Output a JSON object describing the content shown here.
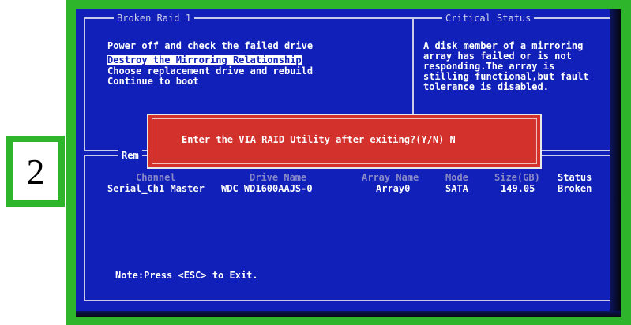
{
  "step_badge": {
    "number": "2"
  },
  "panels": {
    "left": {
      "title": "Broken Raid 1",
      "menu": [
        {
          "label": "Power off and check the failed drive",
          "selected": false
        },
        {
          "label": "Destroy the Mirroring Relationship",
          "selected": true
        },
        {
          "label": "Choose replacement drive and rebuild",
          "selected": false
        },
        {
          "label": "Continue to boot",
          "selected": false
        }
      ]
    },
    "right": {
      "title": "Critical Status",
      "lines": [
        "A disk member of a mirroring",
        "array has failed or is not",
        "responding.The array is",
        "stilling functional,but fault",
        "tolerance is disabled."
      ]
    },
    "bottom": {
      "title": "Rem",
      "columns": [
        "Channel",
        "Drive Name",
        "Array Name",
        "Mode",
        "Size(GB)",
        "Status"
      ],
      "rows": [
        {
          "channel": "Serial_Ch1 Master",
          "drive_name": "WDC WD1600AAJS-0",
          "array_name": "Array0",
          "mode": "SATA",
          "size": "149.05",
          "status": "Broken"
        }
      ],
      "note": "Note:Press <ESC> to Exit."
    }
  },
  "dialog": {
    "prompt": "Enter the VIA RAID Utility after exiting?(Y/N) N"
  },
  "colors": {
    "frame": "#2fb52b",
    "screen_bg": "#1020b8",
    "dialog_bg": "#d2312c"
  }
}
